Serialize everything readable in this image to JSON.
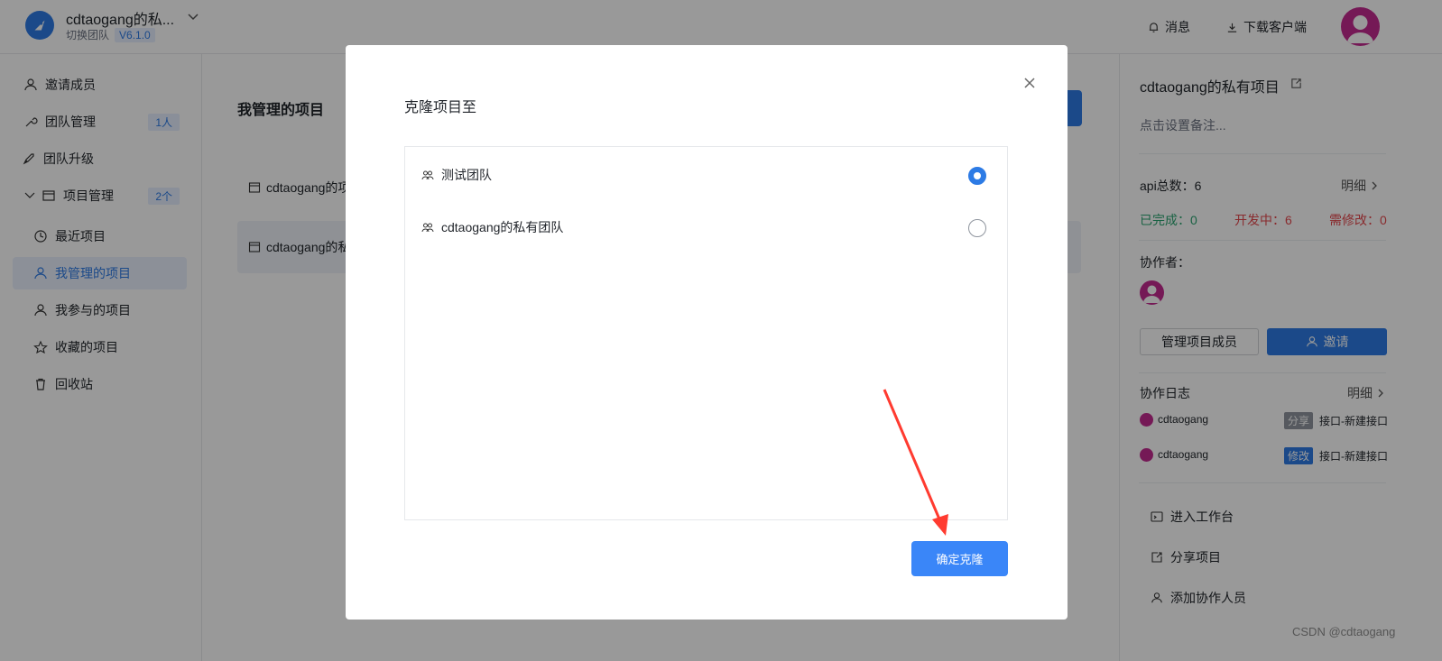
{
  "header": {
    "team_name": "cdtaogang的私...",
    "switch_team": "切换团队",
    "version": "V6.1.0",
    "messages": "消息",
    "download_client": "下载客户端"
  },
  "sidebar": {
    "items": [
      {
        "label": "邀请成员",
        "icon": "user-icon"
      },
      {
        "label": "团队管理",
        "icon": "wrench-icon",
        "badge": "1人"
      },
      {
        "label": "团队升级",
        "icon": "rocket-icon"
      },
      {
        "label": "项目管理",
        "icon": "folder-icon",
        "badge": "2个"
      },
      {
        "label": "最近项目",
        "icon": "clock-icon"
      },
      {
        "label": "我管理的项目",
        "icon": "user-icon",
        "active": true
      },
      {
        "label": "我参与的项目",
        "icon": "user-icon"
      },
      {
        "label": "收藏的项目",
        "icon": "star-icon"
      },
      {
        "label": "回收站",
        "icon": "trash-icon"
      }
    ]
  },
  "main": {
    "title": "我管理的项目",
    "projects": [
      "cdtaogang的项",
      "cdtaogang的私"
    ]
  },
  "right_panel": {
    "project_name": "cdtaogang的私有项目",
    "remark_placeholder": "点击设置备注...",
    "api_total": "api总数：6",
    "detail": "明细",
    "done": "已完成：0",
    "in_dev": "开发中：6",
    "need_fix": "需修改：0",
    "collaborators_label": "协作者：",
    "manage_members": "管理项目成员",
    "invite": "邀请",
    "log_title": "协作日志",
    "logs": [
      {
        "user": "cdtaogang",
        "tag": "分享",
        "tag_color": "#8f959e",
        "action": "接口-新建接口"
      },
      {
        "user": "cdtaogang",
        "tag": "修改",
        "tag_color": "#2d7be5",
        "action": "接口-新建接口"
      }
    ],
    "actions": [
      "进入工作台",
      "分享项目",
      "添加协作人员"
    ]
  },
  "modal": {
    "title": "克隆项目至",
    "options": [
      {
        "label": "测试团队",
        "selected": true
      },
      {
        "label": "cdtaogang的私有团队",
        "selected": false
      }
    ],
    "confirm": "确定克隆"
  },
  "watermark": "CSDN @cdtaogang",
  "colors": {
    "primary": "#2d7be5",
    "done": "#2ba471",
    "in_dev": "#e5484d",
    "annotation_arrow": "#ff3b30"
  }
}
